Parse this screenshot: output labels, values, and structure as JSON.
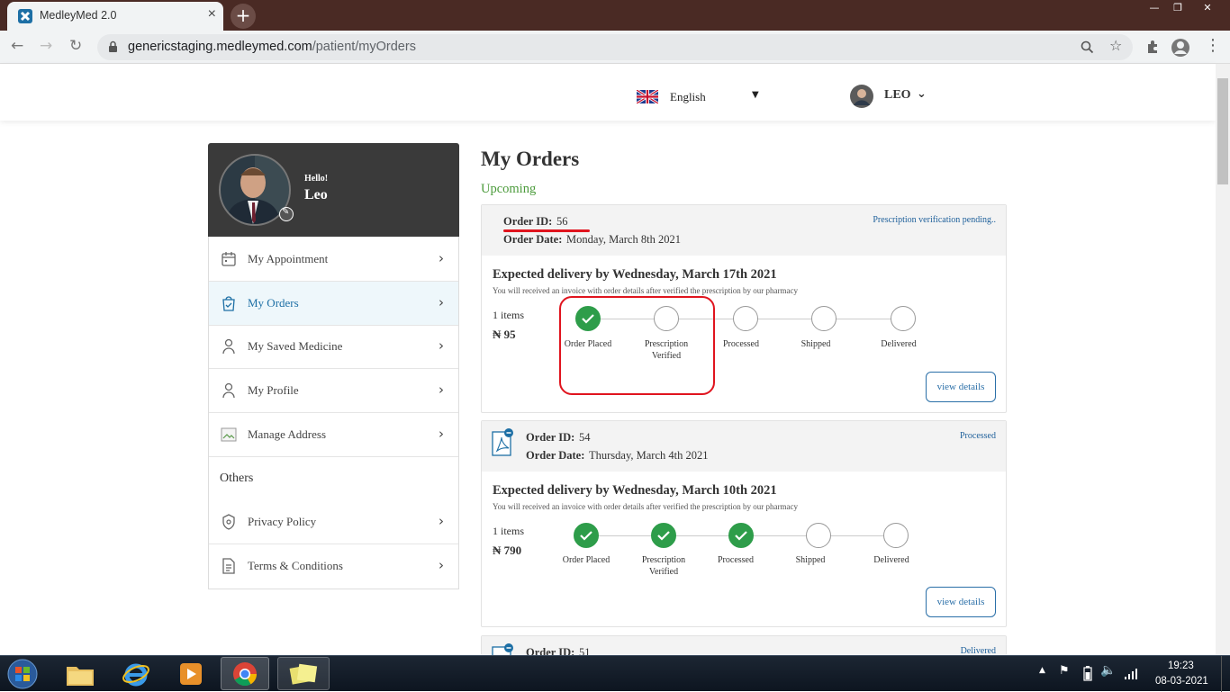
{
  "browser": {
    "tab_title": "MedleyMed 2.0",
    "url_host": "genericstaging.medleymed.com",
    "url_path": "/patient/myOrders"
  },
  "header": {
    "language": "English",
    "username": "LEO"
  },
  "profile": {
    "greeting": "Hello!",
    "name": "Leo"
  },
  "sidebar": {
    "items": [
      {
        "label": "My Appointment",
        "icon": "calendar-icon"
      },
      {
        "label": "My Orders",
        "icon": "shopping-bag-icon",
        "active": true
      },
      {
        "label": "My Saved Medicine",
        "icon": "user-icon"
      },
      {
        "label": "My Profile",
        "icon": "user-icon"
      },
      {
        "label": "Manage Address",
        "icon": "broken-image-icon"
      }
    ],
    "others_heading": "Others",
    "others": [
      {
        "label": "Privacy Policy",
        "icon": "privacy-icon"
      },
      {
        "label": "Terms & Conditions",
        "icon": "document-icon"
      }
    ]
  },
  "main": {
    "title": "My Orders",
    "subtitle": "Upcoming",
    "order_id_label": "Order ID:",
    "order_date_label": "Order Date:",
    "orders": [
      {
        "id": "56",
        "date": "Monday, March 8th 2021",
        "status": "Prescription verification pending..",
        "expected": "Expected delivery by Wednesday, March 17th 2021",
        "note": "You will received an invoice with order details after verified the prescription by our pharmacy",
        "items": "1 items",
        "price": "₦ 95",
        "steps": [
          {
            "label": "Order Placed",
            "done": true
          },
          {
            "label": "Prescription Verified",
            "done": false
          },
          {
            "label": "Processed",
            "done": false
          },
          {
            "label": "Shipped",
            "done": false
          },
          {
            "label": "Delivered",
            "done": false
          }
        ],
        "button": "view details"
      },
      {
        "id": "54",
        "date": "Thursday, March 4th 2021",
        "status": "Processed",
        "expected": "Expected delivery by Wednesday, March 10th 2021",
        "note": "You will received an invoice with order details after verified the prescription by our pharmacy",
        "items": "1 items",
        "price": "₦ 790",
        "steps": [
          {
            "label": "Order Placed",
            "done": true
          },
          {
            "label": "Prescription Verified",
            "done": true
          },
          {
            "label": "Processed",
            "done": true
          },
          {
            "label": "Shipped",
            "done": false
          },
          {
            "label": "Delivered",
            "done": false
          }
        ],
        "button": "view details"
      },
      {
        "id": "51",
        "status": "Delivered"
      }
    ]
  },
  "taskbar": {
    "time": "19:23",
    "date": "08-03-2021"
  },
  "colors": {
    "accent_green": "#2e9d4a",
    "link_blue": "#2a6fa8",
    "annotation_red": "#e0141e",
    "tab_bar": "#4a2a24"
  }
}
